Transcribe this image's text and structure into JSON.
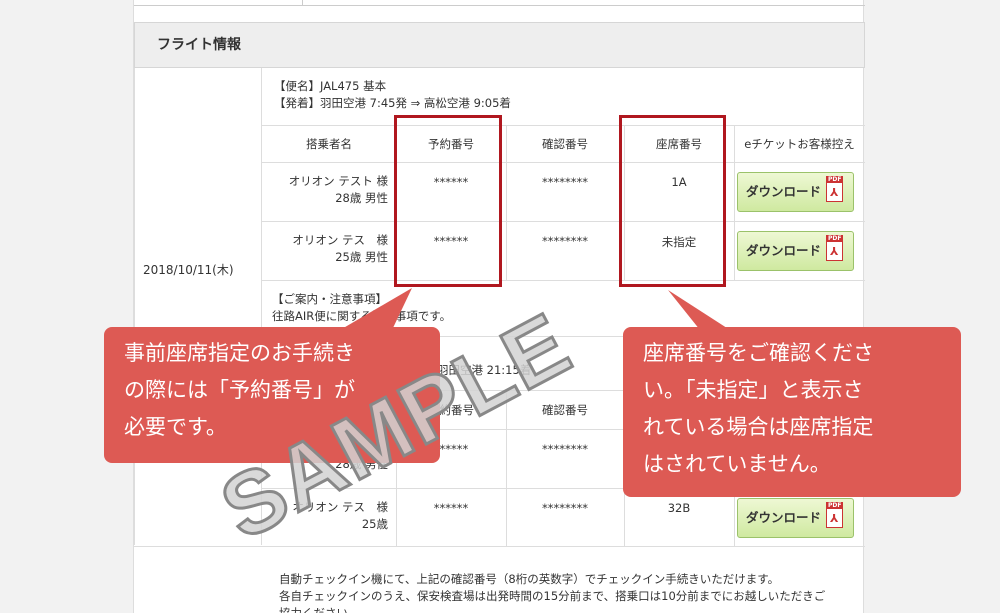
{
  "section": {
    "title": "フライト情報"
  },
  "date": "2018/10/11(木)",
  "flight1": {
    "flight_no": "【便名】JAL475 基本",
    "route": "【発着】羽田空港 7:45発 ⇒ 高松空港 9:05着",
    "headers": [
      "搭乗者名",
      "予約番号",
      "確認番号",
      "座席番号",
      "eチケットお客様控え"
    ],
    "passengers": [
      {
        "name": "オリオン テスト 様",
        "age": "28歳 男性",
        "reservation": "******",
        "confirmation": "********",
        "seat": "1A"
      },
      {
        "name": "オリオン テス　様",
        "age": "25歳 男性",
        "reservation": "******",
        "confirmation": "********",
        "seat": "未指定"
      }
    ],
    "notice_title": "【ご案内・注意事項】",
    "notice_text": "往路AIR便に関する注意事項です。"
  },
  "flight2": {
    "route_tail": "羽田空港 21:15着",
    "headers": [
      "予約番号",
      "確認番号"
    ],
    "passengers": [
      {
        "reservation": "******",
        "confirmation": "********",
        "age": "28歳 男性"
      },
      {
        "name": "オリオン テス　様",
        "age": "25歳",
        "reservation": "******",
        "confirmation": "********",
        "seat": "32B"
      }
    ],
    "notice_lines": [
      "自動チェックイン機にて、上記の確認番号（8桁の英数字）でチェックイン手続きいただけます。",
      "各自チェックインのうえ、保安検査場は出発時間の15分前まで、搭乗口は10分前までにお越しいただきご",
      "協力ください。"
    ]
  },
  "download_label": "ダウンロード",
  "pdf_tag": "PDF",
  "callouts": {
    "left": [
      "事前座席指定のお手続き",
      "の際には「予約番号」が",
      "必要です。"
    ],
    "right": [
      "座席番号をご確認くださ",
      "い。「未指定」と表示さ",
      "れている場合は座席指定",
      "はされていません。"
    ]
  },
  "watermark": "SAMPLE",
  "colors": {
    "callout": "#dd5a54",
    "highlight": "#b0171f",
    "button": "#cfe9a0"
  }
}
